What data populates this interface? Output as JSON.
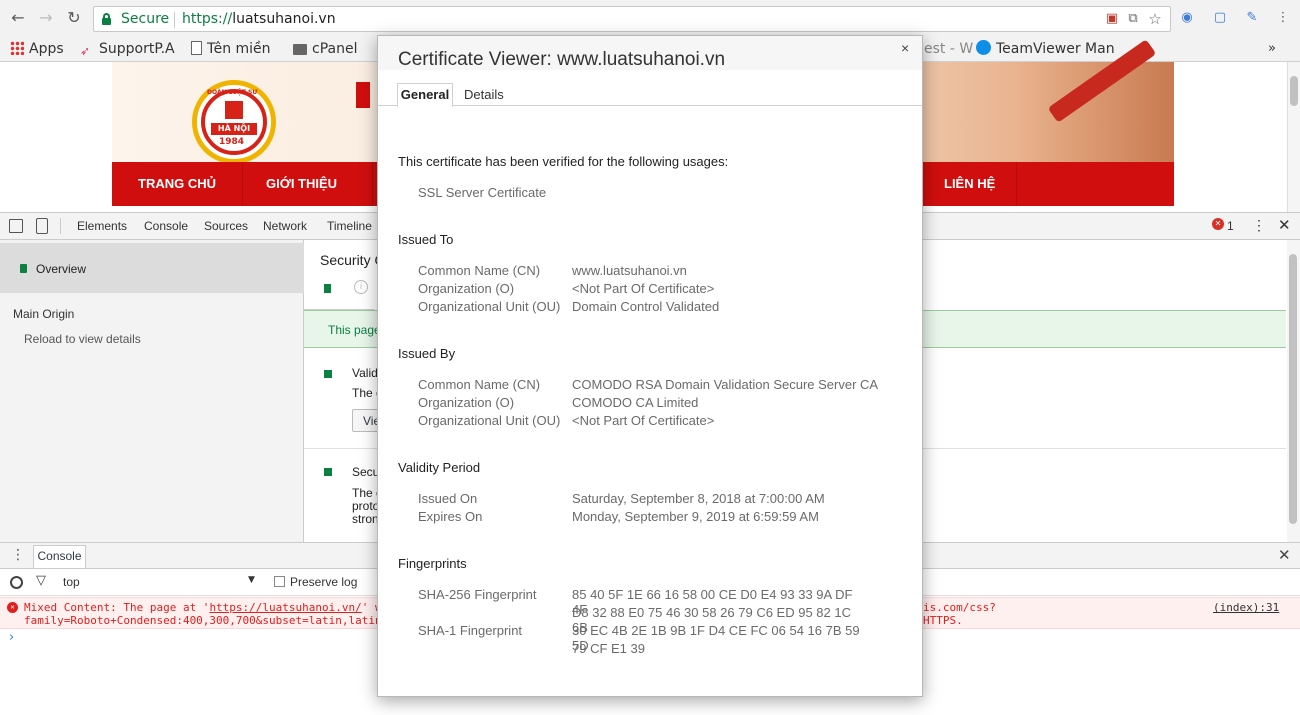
{
  "browser": {
    "secure_label": "Secure",
    "url_proto": "https://",
    "url_host": "luatsuhanoi.vn",
    "bookmarks": [
      {
        "label": "Apps",
        "icon": "apps-grid-icon"
      },
      {
        "label": "SupportP.A",
        "icon": "supportpa-icon"
      },
      {
        "label": "Tên miền",
        "icon": "page-icon"
      },
      {
        "label": "cPanel",
        "icon": "folder-icon"
      },
      {
        "label": "est - W",
        "icon": ""
      },
      {
        "label": "TeamViewer Man",
        "icon": "teamviewer-icon"
      }
    ],
    "bookmarks_more": "»"
  },
  "website": {
    "nav": [
      "TRANG CHỦ",
      "GIỚI THIỆU",
      "LIÊN HỆ"
    ],
    "logo_top": "ĐOÀN LUẬT SƯ",
    "logo_mid": "HÀ NỘI",
    "logo_year": "1984"
  },
  "devtools": {
    "tabs": [
      "Elements",
      "Console",
      "Sources",
      "Network",
      "Timeline"
    ],
    "error_count": "1",
    "sidebar": {
      "overview": "Overview",
      "main_origin": "Main Origin",
      "reload": "Reload to view details"
    },
    "security": {
      "title": "Security O",
      "summary": "This page",
      "item1_title": "Valid",
      "item1_line": "The c",
      "item1_button": "Vie",
      "item2_title": "Secu",
      "item2_lines": [
        "The c",
        "proto",
        "stron"
      ]
    },
    "drawer": {
      "tab": "Console",
      "context": "top",
      "preserve_log": "Preserve log",
      "error_line1_a": "Mixed Content: The page at '",
      "error_line1_link": "https://luatsuhanoi.vn/",
      "error_line1_b": "' w",
      "error_line1_tail": "is.com/css?",
      "error_line2": "family=Roboto+Condensed:400,300,700&subset=latin,latin",
      "error_line2_tail": "HTTPS.",
      "error_source": "(index):31",
      "prompt": "›"
    }
  },
  "certificate": {
    "title": "Certificate Viewer: www.luatsuhanoi.vn",
    "close": "×",
    "tab_general": "General",
    "tab_details": "Details",
    "verified_text": "This certificate has been verified for the following usages:",
    "usage": "SSL Server Certificate",
    "issued_to": {
      "heading": "Issued To",
      "rows": [
        {
          "label": "Common Name (CN)",
          "value": "www.luatsuhanoi.vn"
        },
        {
          "label": "Organization (O)",
          "value": "<Not Part Of Certificate>"
        },
        {
          "label": "Organizational Unit (OU)",
          "value": "Domain Control Validated"
        }
      ]
    },
    "issued_by": {
      "heading": "Issued By",
      "rows": [
        {
          "label": "Common Name (CN)",
          "value": "COMODO RSA Domain Validation Secure Server CA"
        },
        {
          "label": "Organization (O)",
          "value": "COMODO CA Limited"
        },
        {
          "label": "Organizational Unit (OU)",
          "value": "<Not Part Of Certificate>"
        }
      ]
    },
    "validity": {
      "heading": "Validity Period",
      "rows": [
        {
          "label": "Issued On",
          "value": "Saturday, September 8, 2018 at 7:00:00 AM"
        },
        {
          "label": "Expires On",
          "value": "Monday, September 9, 2019 at 6:59:59 AM"
        }
      ]
    },
    "fingerprints": {
      "heading": "Fingerprints",
      "sha256_label": "SHA-256 Fingerprint",
      "sha256_line1": "85 40 5F 1E 66 16 58 00 CE D0 E4 93 33 9A DF 4F",
      "sha256_line2": "D8 32 88 E0 75 46 30 58 26 79 C6 ED 95 82 1C 6B",
      "sha1_label": "SHA-1 Fingerprint",
      "sha1_line1": "30 EC 4B 2E 1B 9B 1F D4 CE FC 06 54 16 7B 59 5D",
      "sha1_line2": "79 CF E1 39"
    }
  }
}
